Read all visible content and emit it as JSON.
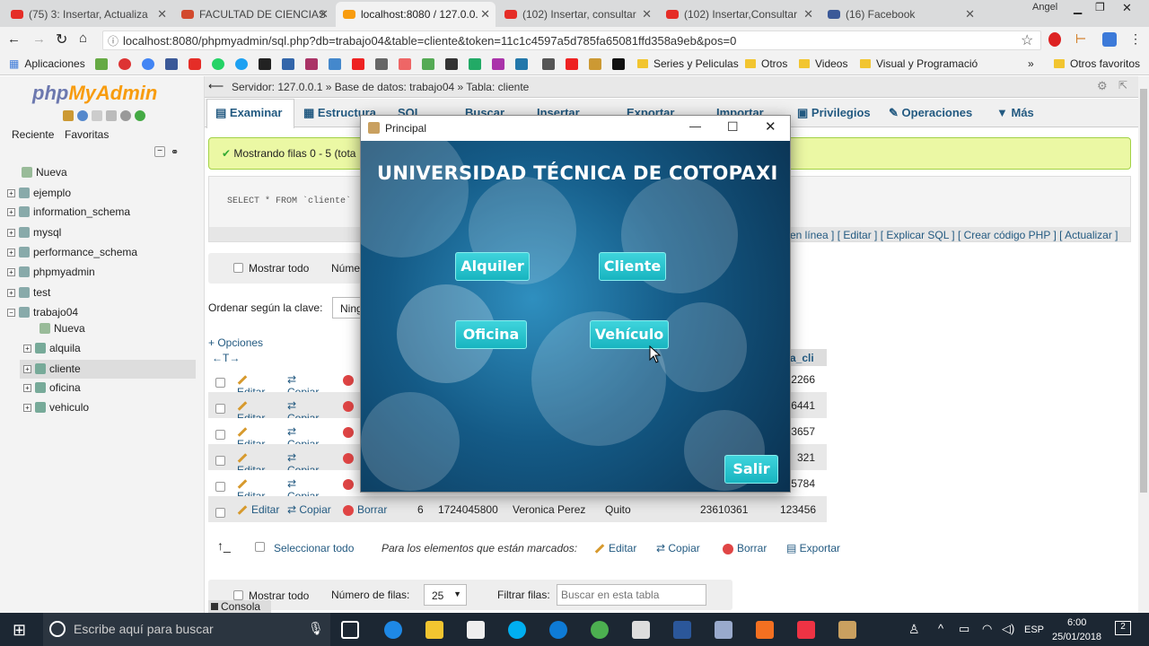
{
  "browser": {
    "tabs": [
      {
        "label": "(75) 3: Insertar, Actualiza",
        "color": "#e52d27"
      },
      {
        "label": "FACULTAD DE CIENCIAS",
        "color": "#d24a2e"
      },
      {
        "label": "localhost:8080 / 127.0.0.",
        "color": "#f89c0e"
      },
      {
        "label": "(102) Insertar, consultar",
        "color": "#e52d27"
      },
      {
        "label": "(102) Insertar,Consultar",
        "color": "#e52d27"
      },
      {
        "label": "(16) Facebook",
        "color": "#3b5998"
      }
    ],
    "profile": "Angel",
    "url": "localhost:8080/phpmyadmin/sql.php?db=trabajo04&table=cliente&token=11c1c4597a5d785fa65081ffd358a9eb&pos=0",
    "bookmarks": {
      "apps": "Aplicaciones",
      "f1": "Series y Peliculas",
      "f2": "Otros",
      "f3": "Videos",
      "f4": "Visual y Programació",
      "more": "»",
      "other": "Otros favoritos"
    }
  },
  "pma": {
    "logo_a": "php",
    "logo_b": "MyAdmin",
    "sidetabs": [
      "Reciente",
      "Favoritas"
    ],
    "tree": [
      "Nueva",
      "ejemplo",
      "information_schema",
      "mysql",
      "performance_schema",
      "phpmyadmin",
      "test",
      "trabajo04"
    ],
    "subtree": [
      "Nueva",
      "alquila",
      "cliente",
      "oficina",
      "vehiculo"
    ],
    "breadcrumb": "Servidor: 127.0.0.1 » Base de datos: trabajo04 » Tabla: cliente",
    "menu": [
      "Examinar",
      "Estructura",
      "SQL",
      "Buscar",
      "Insertar",
      "Exportar",
      "Importar",
      "Privilegios",
      "Operaciones",
      "Más"
    ],
    "success": "Mostrando filas 0 - 5 (tota",
    "sql": "SELECT * FROM `cliente`",
    "sql_links": "en línea ] [ Editar ] [ Explicar SQL ] [ Crear código PHP ] [ Actualizar ]",
    "show_all": "Mostrar todo",
    "num_rows_short": "Núme",
    "order_label": "Ordenar según la clave:",
    "order_value": "Ning",
    "options": "+ Opciones",
    "col_header": "a_cli",
    "row_actions": {
      "edit": "Editar",
      "copy": "Copiar",
      "delete": "Borrar"
    },
    "last_col": [
      "2266",
      "6441",
      "3657",
      "321",
      "5784"
    ],
    "full_row": {
      "id": "6",
      "cedula": "1724045800",
      "nombre": "Veronica Perez",
      "ciudad": "Quito",
      "telefono": "23610361",
      "last": "123456"
    },
    "bottom": {
      "select_all": "Seleccionar todo",
      "marked": "Para los elementos que están marcados:",
      "edit": "Editar",
      "copy": "Copiar",
      "delete": "Borrar",
      "export": "Exportar"
    },
    "footer": {
      "show_all": "Mostrar todo",
      "num_rows": "Número de filas:",
      "num_value": "25",
      "filter": "Filtrar filas:",
      "filter_placeholder": "Buscar en esta tabla"
    },
    "console": "Consola"
  },
  "window": {
    "title": "Principal",
    "heading": "UNIVERSIDAD TÉCNICA DE COTOPAXI",
    "buttons": {
      "alquiler": "Alquiler",
      "cliente": "Cliente",
      "oficina": "Oficina",
      "vehiculo": "Vehículo",
      "salir": "Salir"
    }
  },
  "taskbar": {
    "search": "Escribe aquí para buscar",
    "lang": "ESP",
    "time": "6:00",
    "date": "25/01/2018",
    "notif": "2"
  }
}
